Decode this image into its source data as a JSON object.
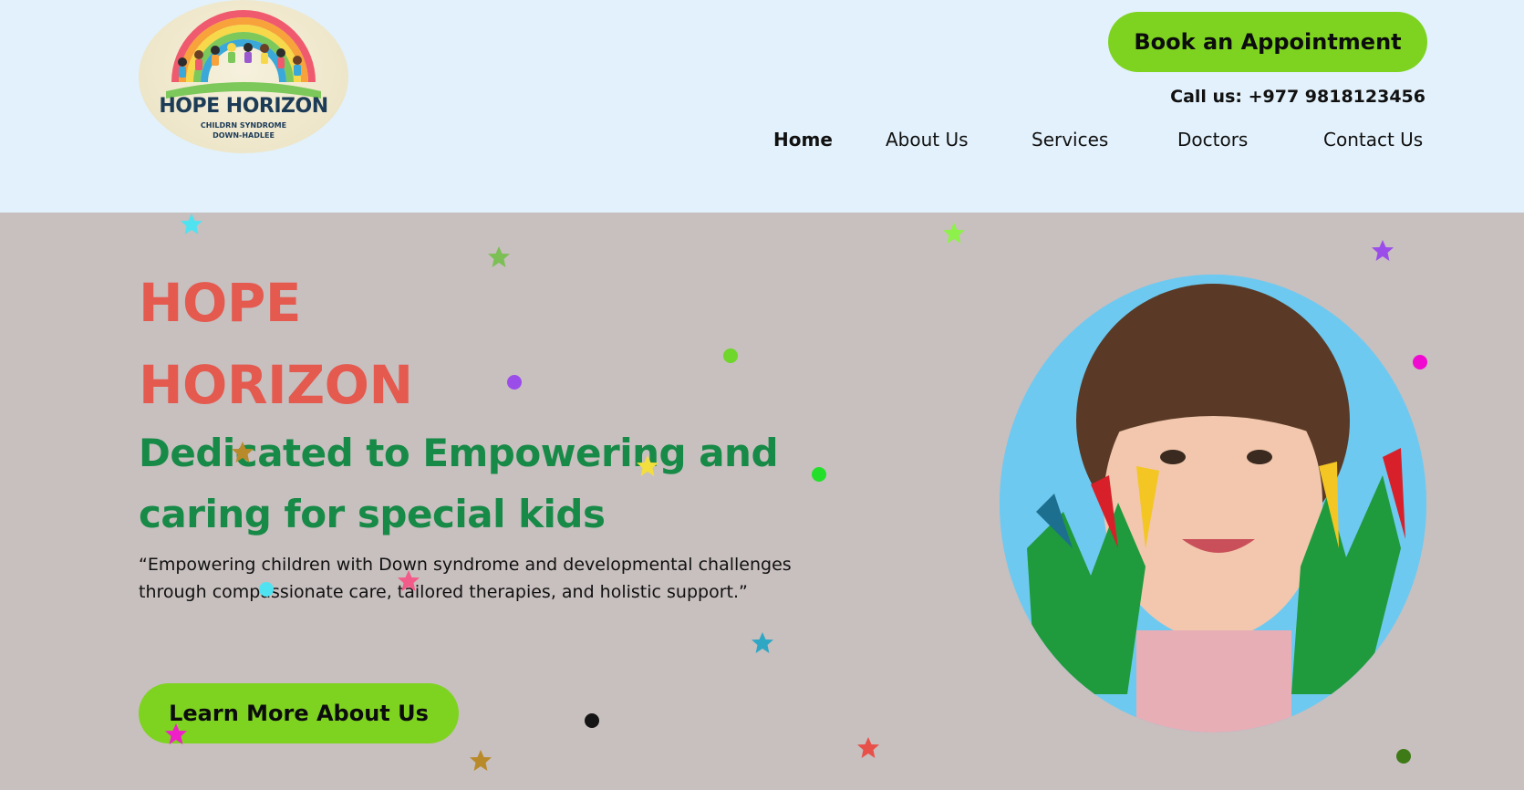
{
  "header": {
    "logo": {
      "title": "HOPE HORIZON",
      "subtitle_line1": "CHILDRN SYNDROME",
      "subtitle_line2": "DOWN-HADLEE"
    },
    "book_button": "Book an Appointment",
    "call_text": "Call us: +977 9818123456",
    "nav": [
      {
        "label": "Home",
        "active": true
      },
      {
        "label": "About Us",
        "active": false
      },
      {
        "label": "Services",
        "active": false
      },
      {
        "label": "Doctors",
        "active": false
      },
      {
        "label": "Contact Us",
        "active": false
      }
    ]
  },
  "hero": {
    "title_line1": "HOPE",
    "title_line2": "HORIZON",
    "tagline_line1": "Dedicated to Empowering and",
    "tagline_line2": "caring for special kids",
    "quote": "“Empowering children with Down syndrome and developmental challenges\n through compassionate care, tailored therapies, and holistic support.”",
    "learn_button": "Learn More About Us",
    "image_icon": "child-portrait-image"
  },
  "colors": {
    "header_bg": "#e2f1fb",
    "hero_bg": "#c8bfbf",
    "accent_green": "#7ed321",
    "title_red": "#e45a4f",
    "tagline_green": "#168a46"
  }
}
